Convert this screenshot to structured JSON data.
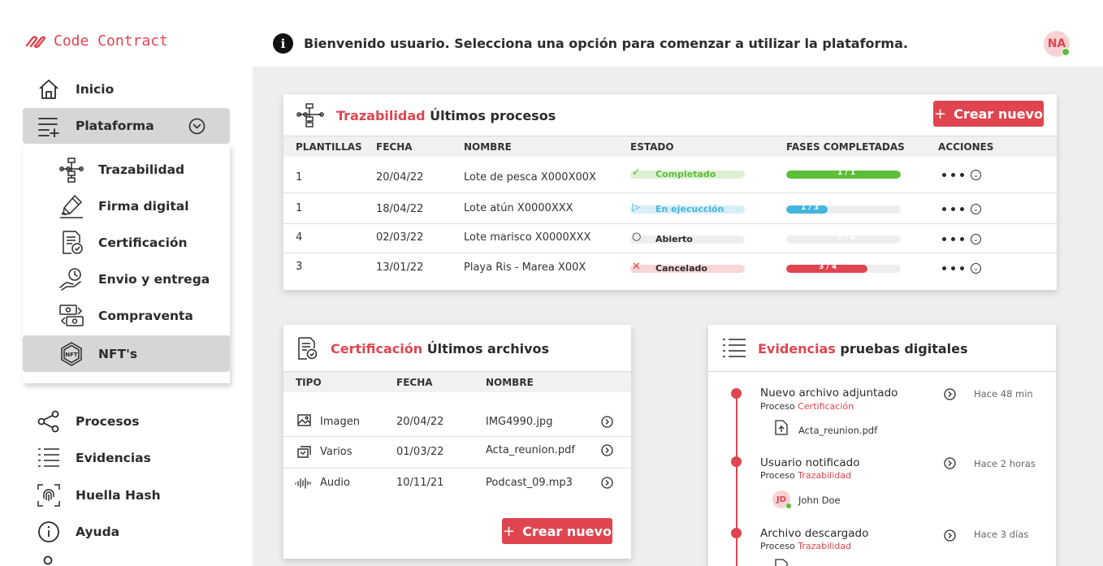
{
  "brand": {
    "name": "Code Contract"
  },
  "header": {
    "welcome": "Bienvenido usuario. Selecciona una opción para comenzar a utilizar la plataforma.",
    "avatar_initials": "NA",
    "info_glyph": "i"
  },
  "sidebar": {
    "items": [
      {
        "label": "Inicio",
        "icon": "home-icon"
      },
      {
        "label": "Plataforma",
        "icon": "list-add-icon"
      },
      {
        "label": "Procesos",
        "icon": "share-icon"
      },
      {
        "label": "Evidencias",
        "icon": "list-icon"
      },
      {
        "label": "Huella Hash",
        "icon": "fingerprint-icon"
      },
      {
        "label": "Ayuda",
        "icon": "info-icon"
      }
    ],
    "submenu": [
      {
        "label": "Trazabilidad",
        "icon": "flow-icon"
      },
      {
        "label": "Firma digital",
        "icon": "signature-icon"
      },
      {
        "label": "Certificación",
        "icon": "certificate-icon"
      },
      {
        "label": "Envio y entrega",
        "icon": "delivery-icon"
      },
      {
        "label": "Compraventa",
        "icon": "exchange-icon"
      },
      {
        "label": "NFT's",
        "icon": "nft-icon"
      }
    ]
  },
  "traz_card": {
    "title_accent": "Trazabilidad",
    "title_rest": "Últimos procesos",
    "create_label": "Crear nuevo",
    "plus": "+",
    "columns": [
      "Plantillas",
      "Fecha",
      "Nombre",
      "Estado",
      "Fases completadas",
      "Acciones"
    ],
    "rows": [
      {
        "template": "1",
        "date": "20/04/22",
        "name": "Lote de pesca X000X00X",
        "status": "Completado",
        "progress_label": "1 / 1",
        "progress": 1.0
      },
      {
        "template": "1",
        "date": "18/04/22",
        "name": "Lote atún X0000XXX",
        "status": "En ejecucción",
        "progress_label": "1 / 3",
        "progress": 0.36
      },
      {
        "template": "4",
        "date": "02/03/22",
        "name": "Lote marisco X0000XXX",
        "status": "Abierto",
        "progress_label": "0 / 4",
        "progress": 0.0
      },
      {
        "template": "3",
        "date": "13/01/22",
        "name": "Playa Ris - Marea X00X",
        "status": "Cancelado",
        "progress_label": "3 / 4",
        "progress": 0.71
      }
    ],
    "status_colors": {
      "completado": "#5cbf3a",
      "ejecucion": "#45b6e0",
      "abierto": "#bbbbbb",
      "cancelado": "#e0454f"
    }
  },
  "cert_card": {
    "title_accent": "Certificación",
    "title_rest": "Últimos archivos",
    "columns": [
      "Tipo",
      "Fecha",
      "Nombre"
    ],
    "rows": [
      {
        "type": "Imagen",
        "date": "20/04/22",
        "name": "IMG4990.jpg",
        "icon": "image-icon"
      },
      {
        "type": "Varios",
        "date": "01/03/22",
        "name": "Acta_reunion.pdf",
        "icon": "files-icon"
      },
      {
        "type": "Audio",
        "date": "10/11/21",
        "name": "Podcast_09.mp3",
        "icon": "audio-icon"
      }
    ],
    "create_label": "Crear nuevo",
    "plus": "+"
  },
  "evid_card": {
    "title_accent": "Evidencias",
    "title_rest": "pruebas digitales",
    "process_prefix": "Proceso",
    "events": [
      {
        "title": "Nuevo archivo adjuntado",
        "process": "Certificación",
        "time": "Hace 48 min",
        "attachment": "Acta_reunion.pdf"
      },
      {
        "title": "Usuario notificado",
        "process": "Trazabilidad",
        "time": "Hace 2 horas",
        "user_initials": "JD",
        "user": "John Doe"
      },
      {
        "title": "Archivo descargado",
        "process": "Trazabilidad",
        "time": "Hace 3 días"
      }
    ]
  }
}
